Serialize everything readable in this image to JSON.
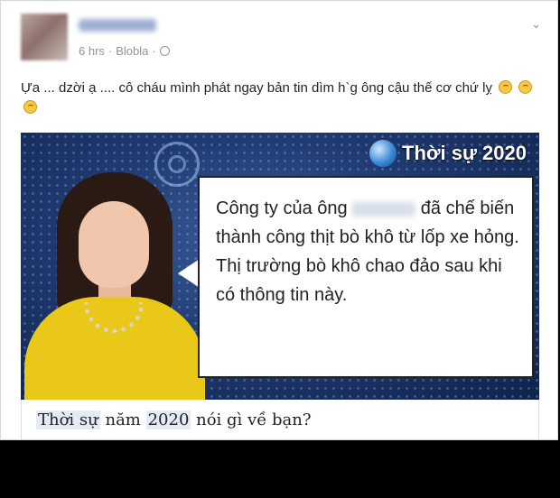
{
  "post": {
    "author": "Trần Lâm",
    "time": "6 hrs",
    "separator": "·",
    "location": "Blobla",
    "privacy_icon": "globe-icon",
    "text": "Ựa ... dzời ạ .... cô cháu mình phát ngay bản tin dìm h`g ông cậu thế cơ chứ lỵ",
    "menu_icon": "chevron-down-icon"
  },
  "media": {
    "channel_label": "Thời sự 2020",
    "speech": {
      "line1_prefix": "Công ty của ông",
      "blurred_name": "Trần Lâm",
      "line1_suffix": "đã chế",
      "rest": "biến thành công thịt bò khô từ lốp xe hỏng. Thị trường bò khô chao đảo sau khi có thông tin này."
    }
  },
  "link": {
    "title_part1": "Thời sự",
    "title_part2": " năm ",
    "title_part3": "2020",
    "title_part4": " nói gì về bạn?"
  },
  "colors": {
    "accent": "#e9c819",
    "background": "#000000",
    "card": "#ffffff"
  }
}
